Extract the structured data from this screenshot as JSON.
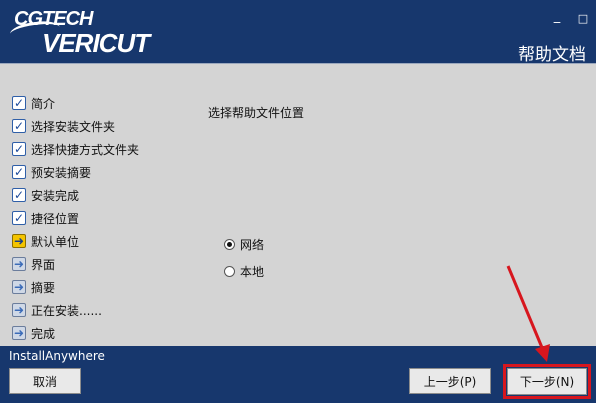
{
  "header": {
    "logo_top": "CGTECH",
    "logo_main": "VERICUT",
    "title": "帮助文档",
    "minimize_glyph": "_",
    "close_glyph": "□"
  },
  "steps": [
    {
      "label": "简介",
      "state": "done"
    },
    {
      "label": "选择安装文件夹",
      "state": "done"
    },
    {
      "label": "选择快捷方式文件夹",
      "state": "done"
    },
    {
      "label": "预安装摘要",
      "state": "done"
    },
    {
      "label": "安装完成",
      "state": "done"
    },
    {
      "label": "捷径位置",
      "state": "done"
    },
    {
      "label": "默认单位",
      "state": "current"
    },
    {
      "label": "界面",
      "state": "pending"
    },
    {
      "label": "摘要",
      "state": "pending"
    },
    {
      "label": "正在安装......",
      "state": "pending"
    },
    {
      "label": "完成",
      "state": "pending"
    }
  ],
  "main": {
    "heading": "选择帮助文件位置",
    "options": [
      {
        "label": "网络",
        "selected": true
      },
      {
        "label": "本地",
        "selected": false
      }
    ]
  },
  "footer": {
    "brand": "InstallAnywhere",
    "cancel_label": "取消",
    "prev_label": "上一步(P)",
    "next_label": "下一步(N)"
  },
  "colors": {
    "header_bg": "#17376d",
    "panel_bg": "#d4d4d4",
    "highlight": "#d7161e",
    "current_step": "#f4c400"
  },
  "icons": {
    "done": "checkmark-icon",
    "current": "arrow-right-icon",
    "pending": "arrow-right-icon"
  }
}
